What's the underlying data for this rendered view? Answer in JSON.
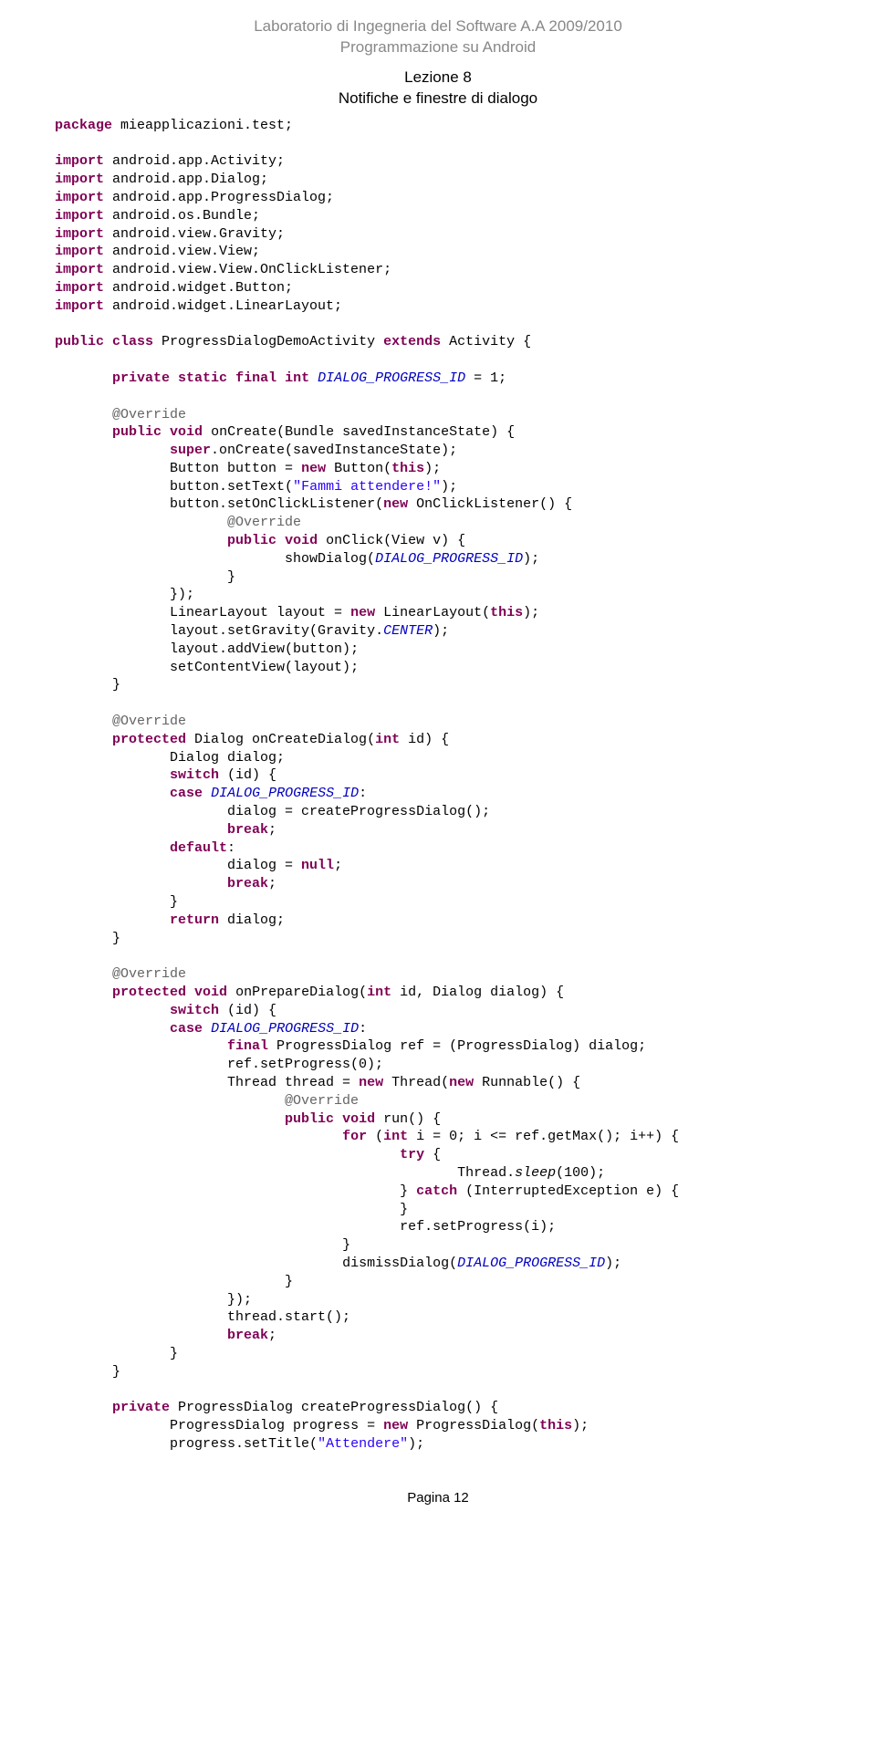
{
  "header": {
    "line1": "Laboratorio di Ingegneria del Software A.A 2009/2010",
    "line2": "Programmazione su Android"
  },
  "lesson": {
    "line1": "Lezione 8",
    "line2": "Notifiche e finestre di dialogo"
  },
  "code": {
    "t01": "package",
    "t02": " mieapplicazioni.test;",
    "t03": "import",
    "t04": " android.app.Activity;",
    "t05": " android.app.Dialog;",
    "t06": " android.app.ProgressDialog;",
    "t07": " android.os.Bundle;",
    "t08": " android.view.Gravity;",
    "t09": " android.view.View;",
    "t10": " android.view.View.OnClickListener;",
    "t11": " android.widget.Button;",
    "t12": " android.widget.LinearLayout;",
    "t13": "public",
    "t14": "class",
    "t15": " ProgressDialogDemoActivity ",
    "t16": "extends",
    "t17": " Activity {",
    "t18": "private",
    "t19": "static",
    "t20": "final",
    "t21": "int",
    "t22": "DIALOG_PROGRESS_ID",
    "t23": " = 1;",
    "t24": "@Override",
    "t25": "public",
    "t26": "void",
    "t27": " onCreate(Bundle savedInstanceState) {",
    "t28": "super",
    "t29": ".onCreate(savedInstanceState);",
    "t30": "Button button = ",
    "t31": "new",
    "t32": " Button(",
    "t33": "this",
    "t34": ");",
    "t35": "button.setText(",
    "t36": "\"Fammi attendere!\"",
    "t37": "button.setOnClickListener(",
    "t38": " OnClickListener() {",
    "t39": " onClick(View v) {",
    "t40": "showDialog(",
    "t41": "});",
    "t42": "LinearLayout layout = ",
    "t43": " LinearLayout(",
    "t44": "layout.setGravity(Gravity.",
    "t45": "CENTER",
    "t46": "layout.addView(button);",
    "t47": "setContentView(layout);",
    "t48": "protected",
    "t49": " Dialog onCreateDialog(",
    "t50": " id) {",
    "t51": "Dialog dialog;",
    "t52": "switch",
    "t53": " (id) {",
    "t54": "case",
    "t55": ":",
    "t56": "dialog = createProgressDialog();",
    "t57": "break",
    "t58": "default",
    "t59": "dialog = ",
    "t60": "null",
    "t61": "return",
    "t62": " dialog;",
    "t63": " onPrepareDialog(",
    "t64": " id, Dialog dialog) {",
    "t65": " ProgressDialog ref = (ProgressDialog) dialog;",
    "t66": "ref.setProgress(0);",
    "t67": "Thread thread = ",
    "t68": " Thread(",
    "t69": " Runnable() {",
    "t70": " run() {",
    "t71": "for",
    "t72": " (",
    "t73": " i = 0; i <= ref.getMax(); i++) {",
    "t74": "try",
    "t75": " {",
    "t76": "Thread.",
    "t77": "sleep",
    "t78": "(100);",
    "t79": "catch",
    "t80": " (InterruptedException e) {",
    "t81": "ref.setProgress(i);",
    "t82": "dismissDialog(",
    "t83": "thread.start();",
    "t84": " ProgressDialog createProgressDialog() {",
    "t85": "ProgressDialog progress = ",
    "t86": " ProgressDialog(",
    "t87": "progress.setTitle(",
    "t88": "\"Attendere\"",
    "brace_close": "}",
    "semicolon": ";"
  },
  "footer": "Pagina 12"
}
